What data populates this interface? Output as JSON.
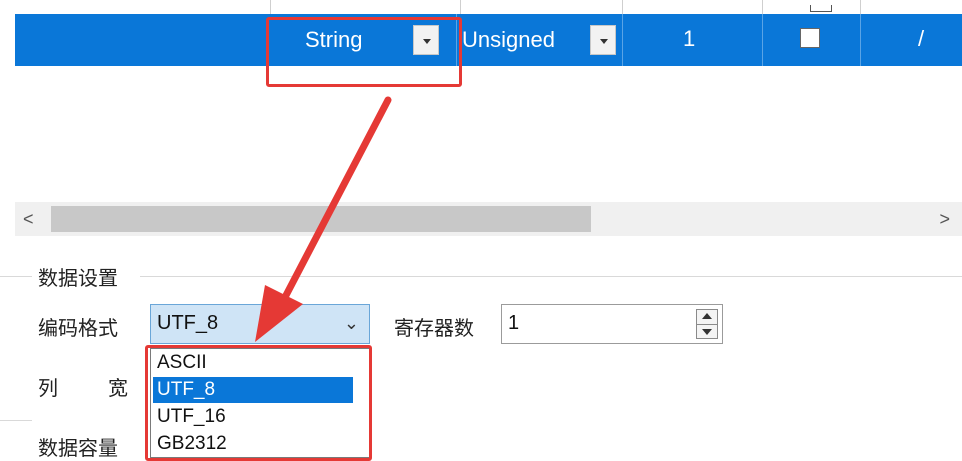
{
  "table": {
    "previous_row_partial_text": "Unsigned",
    "selected_row": {
      "type_value": "String",
      "sign_value": "Unsigned",
      "count_value": "1",
      "checked": false,
      "last_value": "/"
    }
  },
  "scrollbar": {
    "left_arrow": "<",
    "right_arrow": ">",
    "position_fraction": 0.0
  },
  "data_settings": {
    "group_title": "数据设置",
    "encoding_label": "编码格式",
    "encoding_value": "UTF_8",
    "register_label": "寄存器数",
    "register_value": "1",
    "column_label_1": "列",
    "column_label_2": "宽",
    "encoding_options": [
      "ASCII",
      "UTF_8",
      "UTF_16",
      "GB2312"
    ],
    "selected_option_index": 1
  },
  "data_capacity": {
    "group_title": "数据容量"
  },
  "annotation": {
    "highlight_color": "#e53935",
    "selection_color": "#0a77d8"
  }
}
